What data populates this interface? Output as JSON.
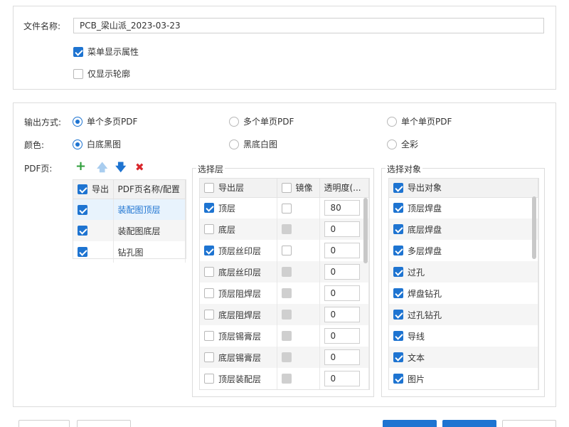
{
  "top": {
    "filename_label": "文件名称:",
    "filename_value": "PCB_梁山派_2023-03-23",
    "opt_menu_attr": "菜单显示属性",
    "opt_outline_only": "仅显示轮廓"
  },
  "output": {
    "mode_label": "输出方式:",
    "mode_opts": [
      "单个多页PDF",
      "多个单页PDF",
      "单个单页PDF"
    ],
    "color_label": "颜色:",
    "color_opts": [
      "白底黑图",
      "黑底白图",
      "全彩"
    ]
  },
  "pages": {
    "label": "PDF页:",
    "col_export": "导出",
    "col_name": "PDF页名称/配置",
    "rows": [
      {
        "name": "装配图顶层",
        "checked": true
      },
      {
        "name": "装配图底层",
        "checked": true
      },
      {
        "name": "钻孔图",
        "checked": true
      }
    ]
  },
  "layers": {
    "title": "选择层",
    "col_export": "导出层",
    "col_mirror": "镜像",
    "col_opacity": "透明度(...",
    "rows": [
      {
        "name": "顶层",
        "checked": true,
        "mirror": "empty",
        "opacity": "80"
      },
      {
        "name": "底层",
        "checked": false,
        "mirror": "disabled",
        "opacity": "0"
      },
      {
        "name": "顶层丝印层",
        "checked": true,
        "mirror": "empty",
        "opacity": "0"
      },
      {
        "name": "底层丝印层",
        "checked": false,
        "mirror": "disabled",
        "opacity": "0"
      },
      {
        "name": "顶层阻焊层",
        "checked": false,
        "mirror": "disabled",
        "opacity": "0"
      },
      {
        "name": "底层阻焊层",
        "checked": false,
        "mirror": "disabled",
        "opacity": "0"
      },
      {
        "name": "顶层锡膏层",
        "checked": false,
        "mirror": "disabled",
        "opacity": "0"
      },
      {
        "name": "底层锡膏层",
        "checked": false,
        "mirror": "disabled",
        "opacity": "0"
      },
      {
        "name": "顶层装配层",
        "checked": false,
        "mirror": "disabled",
        "opacity": "0"
      }
    ]
  },
  "objects": {
    "title": "选择对象",
    "col_export": "导出对象",
    "rows": [
      "顶层焊盘",
      "底层焊盘",
      "多层焊盘",
      "过孔",
      "焊盘钻孔",
      "过孔钻孔",
      "导线",
      "文本",
      "图片"
    ]
  },
  "colors": {
    "accent": "#1e74d1",
    "add": "#2e9e3a",
    "delete": "#d9262b"
  },
  "icons": [
    "add-icon",
    "move-up-icon",
    "move-down-icon",
    "delete-icon"
  ]
}
